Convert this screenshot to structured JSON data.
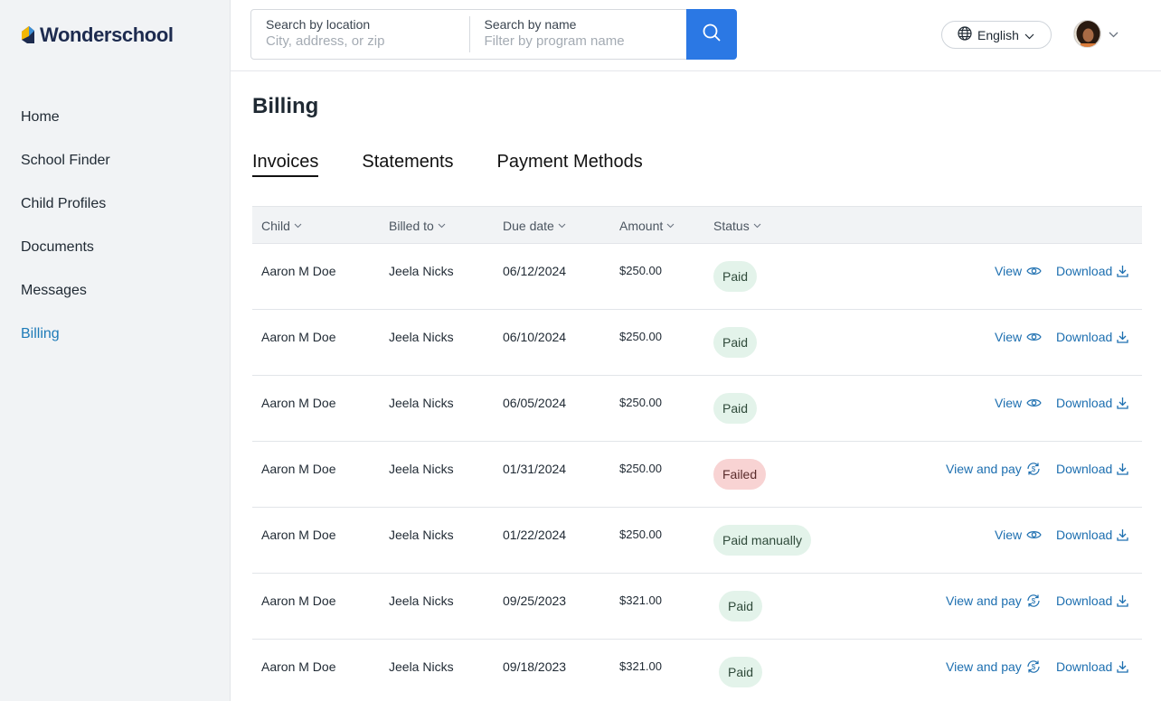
{
  "brand": {
    "name": "Wonderschool"
  },
  "sidebar": {
    "items": [
      {
        "label": "Home"
      },
      {
        "label": "School Finder"
      },
      {
        "label": "Child Profiles"
      },
      {
        "label": "Documents"
      },
      {
        "label": "Messages"
      },
      {
        "label": "Billing"
      }
    ]
  },
  "search": {
    "location_label": "Search by location",
    "location_placeholder": "City, address, or zip",
    "name_label": "Search by name",
    "name_placeholder": "Filter by program name"
  },
  "language": {
    "selected": "English"
  },
  "page": {
    "title": "Billing"
  },
  "tabs": [
    {
      "label": "Invoices"
    },
    {
      "label": "Statements"
    },
    {
      "label": "Payment Methods"
    }
  ],
  "table": {
    "headers": {
      "child": "Child",
      "billed_to": "Billed to",
      "due_date": "Due date",
      "amount": "Amount",
      "status": "Status"
    },
    "actions": {
      "view": "View",
      "view_and_pay": "View and pay",
      "download": "Download"
    },
    "rows": [
      {
        "child": "Aaron M Doe",
        "billed_to": "Jeela Nicks",
        "due_date": "06/12/2024",
        "amount": "$250.00",
        "status": "Paid"
      },
      {
        "child": "Aaron M Doe",
        "billed_to": "Jeela Nicks",
        "due_date": "06/10/2024",
        "amount": "$250.00",
        "status": "Paid"
      },
      {
        "child": "Aaron M Doe",
        "billed_to": "Jeela Nicks",
        "due_date": "06/05/2024",
        "amount": "$250.00",
        "status": "Paid"
      },
      {
        "child": "Aaron M Doe",
        "billed_to": "Jeela Nicks",
        "due_date": "01/31/2024",
        "amount": "$250.00",
        "status": "Failed"
      },
      {
        "child": "Aaron M Doe",
        "billed_to": "Jeela Nicks",
        "due_date": "01/22/2024",
        "amount": "$250.00",
        "status": "Paid manually"
      },
      {
        "child": "Aaron M Doe",
        "billed_to": "Jeela Nicks",
        "due_date": "09/25/2023",
        "amount": "$321.00",
        "status": "Paid"
      },
      {
        "child": "Aaron M Doe",
        "billed_to": "Jeela Nicks",
        "due_date": "09/18/2023",
        "amount": "$321.00",
        "status": "Paid"
      }
    ]
  },
  "colors": {
    "accent": "#2b78e4",
    "link": "#1d6fb0",
    "paid_bg": "#e3f3ea",
    "failed_bg": "#f8d3d3"
  }
}
